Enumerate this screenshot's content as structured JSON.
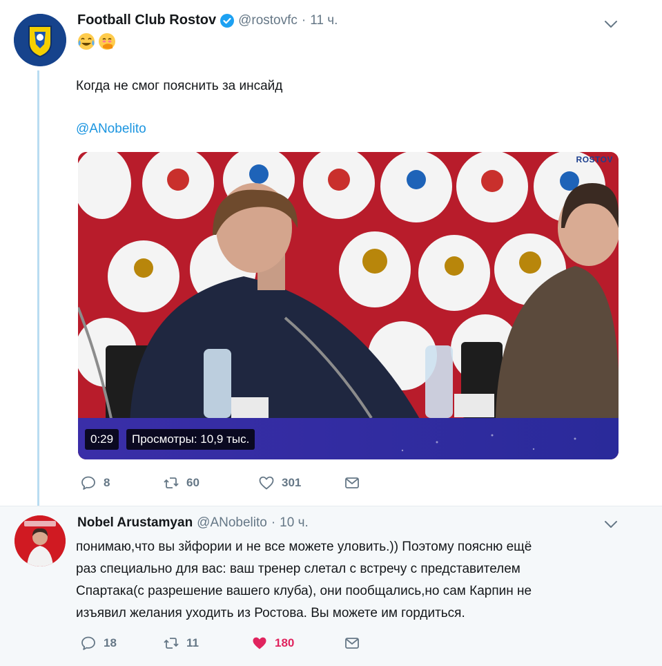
{
  "tweet": {
    "author_name": "Football Club Rostov",
    "handle": "@rostovfc",
    "separator": "·",
    "time": "11 ч.",
    "emojis": [
      "crying-laughing-emoji",
      "hand-over-mouth-emoji"
    ],
    "text": "Когда не смог пояснить за инсайд",
    "mention": "@ANobelito",
    "video": {
      "duration": "0:29",
      "views": "Просмотры: 10,9 тыс.",
      "watermark": "ROSTOV"
    },
    "actions": {
      "replies": "8",
      "retweets": "60",
      "likes": "301"
    }
  },
  "reply": {
    "author_name": "Nobel Arustamyan",
    "handle": "@ANobelito",
    "separator": "·",
    "time": "10 ч.",
    "lines": [
      "понимаю,что вы зйфории и не все можете уловить.)) Поэтому поясню ещё",
      "раз специально для вас: ваш тренер слетал с встречу с представителем",
      "Спартака(с разрешение вашего клуба), они пообщались,но сам Карпин не",
      "изъявил желания уходить из Ростова. Вы можете им гордиться."
    ],
    "actions": {
      "replies": "18",
      "retweets": "11",
      "likes": "180"
    }
  },
  "colors": {
    "link": "#1b95e0",
    "muted": "#657786",
    "like_active": "#e0245e",
    "thread_line": "#b9dcf1"
  }
}
